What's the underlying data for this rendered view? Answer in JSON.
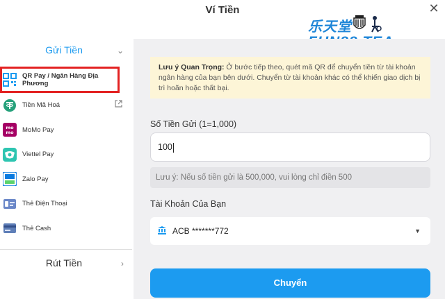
{
  "header": {
    "title": "Ví Tiền",
    "close": "✕"
  },
  "brand": {
    "cn": "乐天堂",
    "en": "FUN88 TEA"
  },
  "sidebar": {
    "deposit_label": "Gửi Tiền",
    "withdraw_label": "Rút Tiền",
    "items": [
      {
        "label": "QR Pay / Ngân Hàng Địa Phương",
        "icon": "qr-code-icon",
        "active": true
      },
      {
        "label": "Tiền Mã Hoá",
        "icon": "tether-icon",
        "external": true
      },
      {
        "label": "MoMo Pay",
        "icon": "momo-icon"
      },
      {
        "label": "Viettel Pay",
        "icon": "viettel-pay-icon"
      },
      {
        "label": "Zalo Pay",
        "icon": "zalo-pay-icon"
      },
      {
        "label": "Thẻ Điện Thoại",
        "icon": "phone-card-icon"
      },
      {
        "label": "Thẻ Cash",
        "icon": "cash-card-icon"
      }
    ]
  },
  "notice": {
    "bold": "Lưu ý Quan Trọng:",
    "text": " Ở bước tiếp theo, quét mã QR để chuyển tiền từ tài khoản ngân hàng của bạn bên dưới. Chuyển từ tài khoản khác có thể khiến giao dịch bị trì hoãn hoặc thất bại."
  },
  "form": {
    "amount_label": "Số Tiền Gửi (1=1,000)",
    "amount_value": "100",
    "hint": "Lưu ý: Nếu số tiền gửi là 500,000, vui lòng chỉ điền 500",
    "account_label": "Tài Khoản Của Bạn",
    "account_value": "ACB *******772",
    "submit_label": "Chuyển"
  },
  "colors": {
    "accent": "#1c9bf0",
    "highlight": "#e32222",
    "notice_bg": "#fdf5d7"
  }
}
